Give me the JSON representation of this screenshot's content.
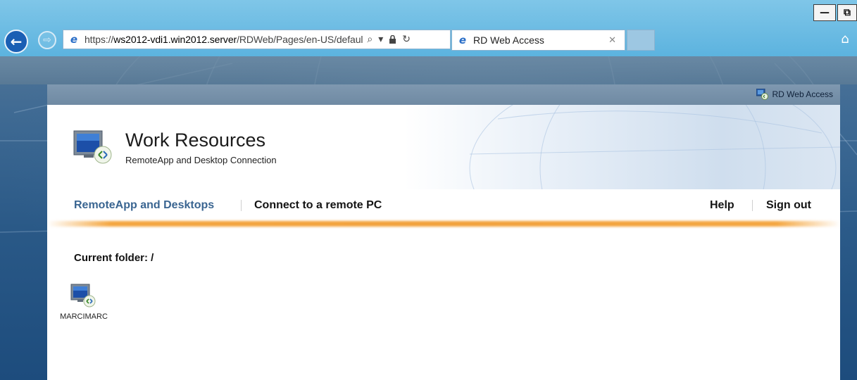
{
  "window_controls": {
    "minimize": "—",
    "restore": "⧉"
  },
  "browser": {
    "back_icon": "←",
    "forward_icon": "⇨",
    "address": {
      "scheme": "https://",
      "host": "ws2012-vdi1.win2012.server",
      "path": "/RDWeb/Pages/en-US/defaul"
    },
    "address_tools": {
      "search": "⌕",
      "dropdown": "▾",
      "lock": "🔒",
      "refresh": "↻"
    },
    "tab": {
      "label": "RD Web Access",
      "close": "✕"
    },
    "home_icon": "⌂"
  },
  "page": {
    "top_label": "RD Web Access",
    "brand_title": "Work Resources",
    "brand_subtitle": "RemoteApp and Desktop Connection",
    "nav": {
      "remoteapp": "RemoteApp and Desktops",
      "connect": "Connect to a remote PC",
      "help": "Help",
      "signout": "Sign out"
    },
    "current_folder": "Current folder: /",
    "apps": [
      {
        "label": "MARCIMARC"
      }
    ]
  },
  "colors": {
    "chrome": "#5cb3df",
    "nav_active": "#3a6591",
    "accent_orange": "#f2a13b"
  }
}
